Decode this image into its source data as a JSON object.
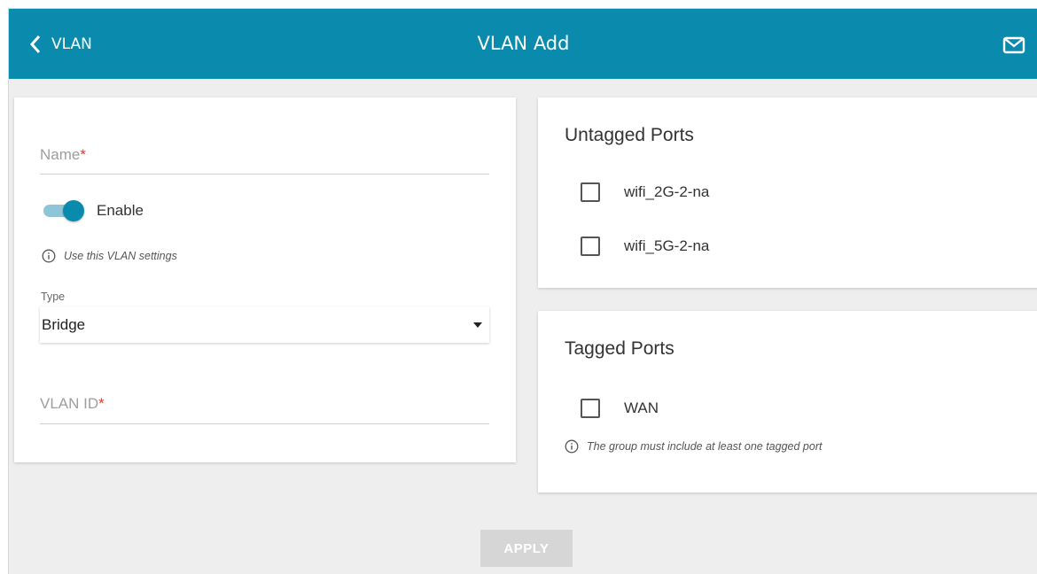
{
  "header": {
    "back_label": "VLAN",
    "title": "VLAN Add",
    "color": "#0a8aad"
  },
  "form": {
    "name_label": "Name",
    "required_mark": "*",
    "enable_label": "Enable",
    "enable_state": true,
    "enable_hint": "Use this VLAN settings",
    "type_label": "Type",
    "type_value": "Bridge",
    "vlan_id_label": "VLAN ID"
  },
  "untagged": {
    "title": "Untagged Ports",
    "ports": [
      {
        "label": "wifi_2G-2-na",
        "checked": false
      },
      {
        "label": "wifi_5G-2-na",
        "checked": false
      }
    ]
  },
  "tagged": {
    "title": "Tagged Ports",
    "ports": [
      {
        "label": "WAN",
        "checked": false
      }
    ],
    "hint": "The group must include at least one tagged port"
  },
  "actions": {
    "apply_label": "APPLY"
  },
  "icons": {
    "back": "chevron-left-icon",
    "mail": "mail-icon",
    "info": "info-icon",
    "dropdown": "caret-down-icon"
  }
}
